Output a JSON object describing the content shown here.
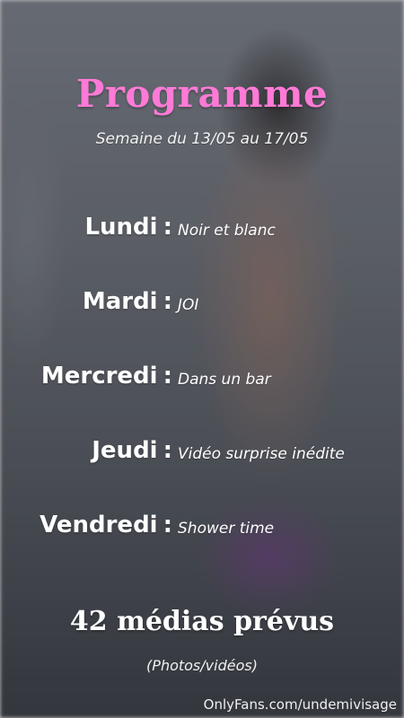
{
  "title": "Programme",
  "subtitle": "Semaine du 13/05 au 17/05",
  "schedule": [
    {
      "day": "Lundi",
      "colon": ":",
      "activity": "Noir et blanc"
    },
    {
      "day": "Mardi",
      "colon": ":",
      "activity": "JOI"
    },
    {
      "day": "Mercredi",
      "colon": ":",
      "activity": "Dans un bar"
    },
    {
      "day": "Jeudi",
      "colon": ":",
      "activity": "Vidéo surprise inédite"
    },
    {
      "day": "Vendredi",
      "colon": ":",
      "activity": "Shower time"
    }
  ],
  "footer": {
    "medias": "42 médias prévus",
    "note": "(Photos/vidéos)"
  },
  "watermark": "OnlyFans.com/undemivisage",
  "colors": {
    "title": "#ff7ad6",
    "text": "#ffffff"
  }
}
